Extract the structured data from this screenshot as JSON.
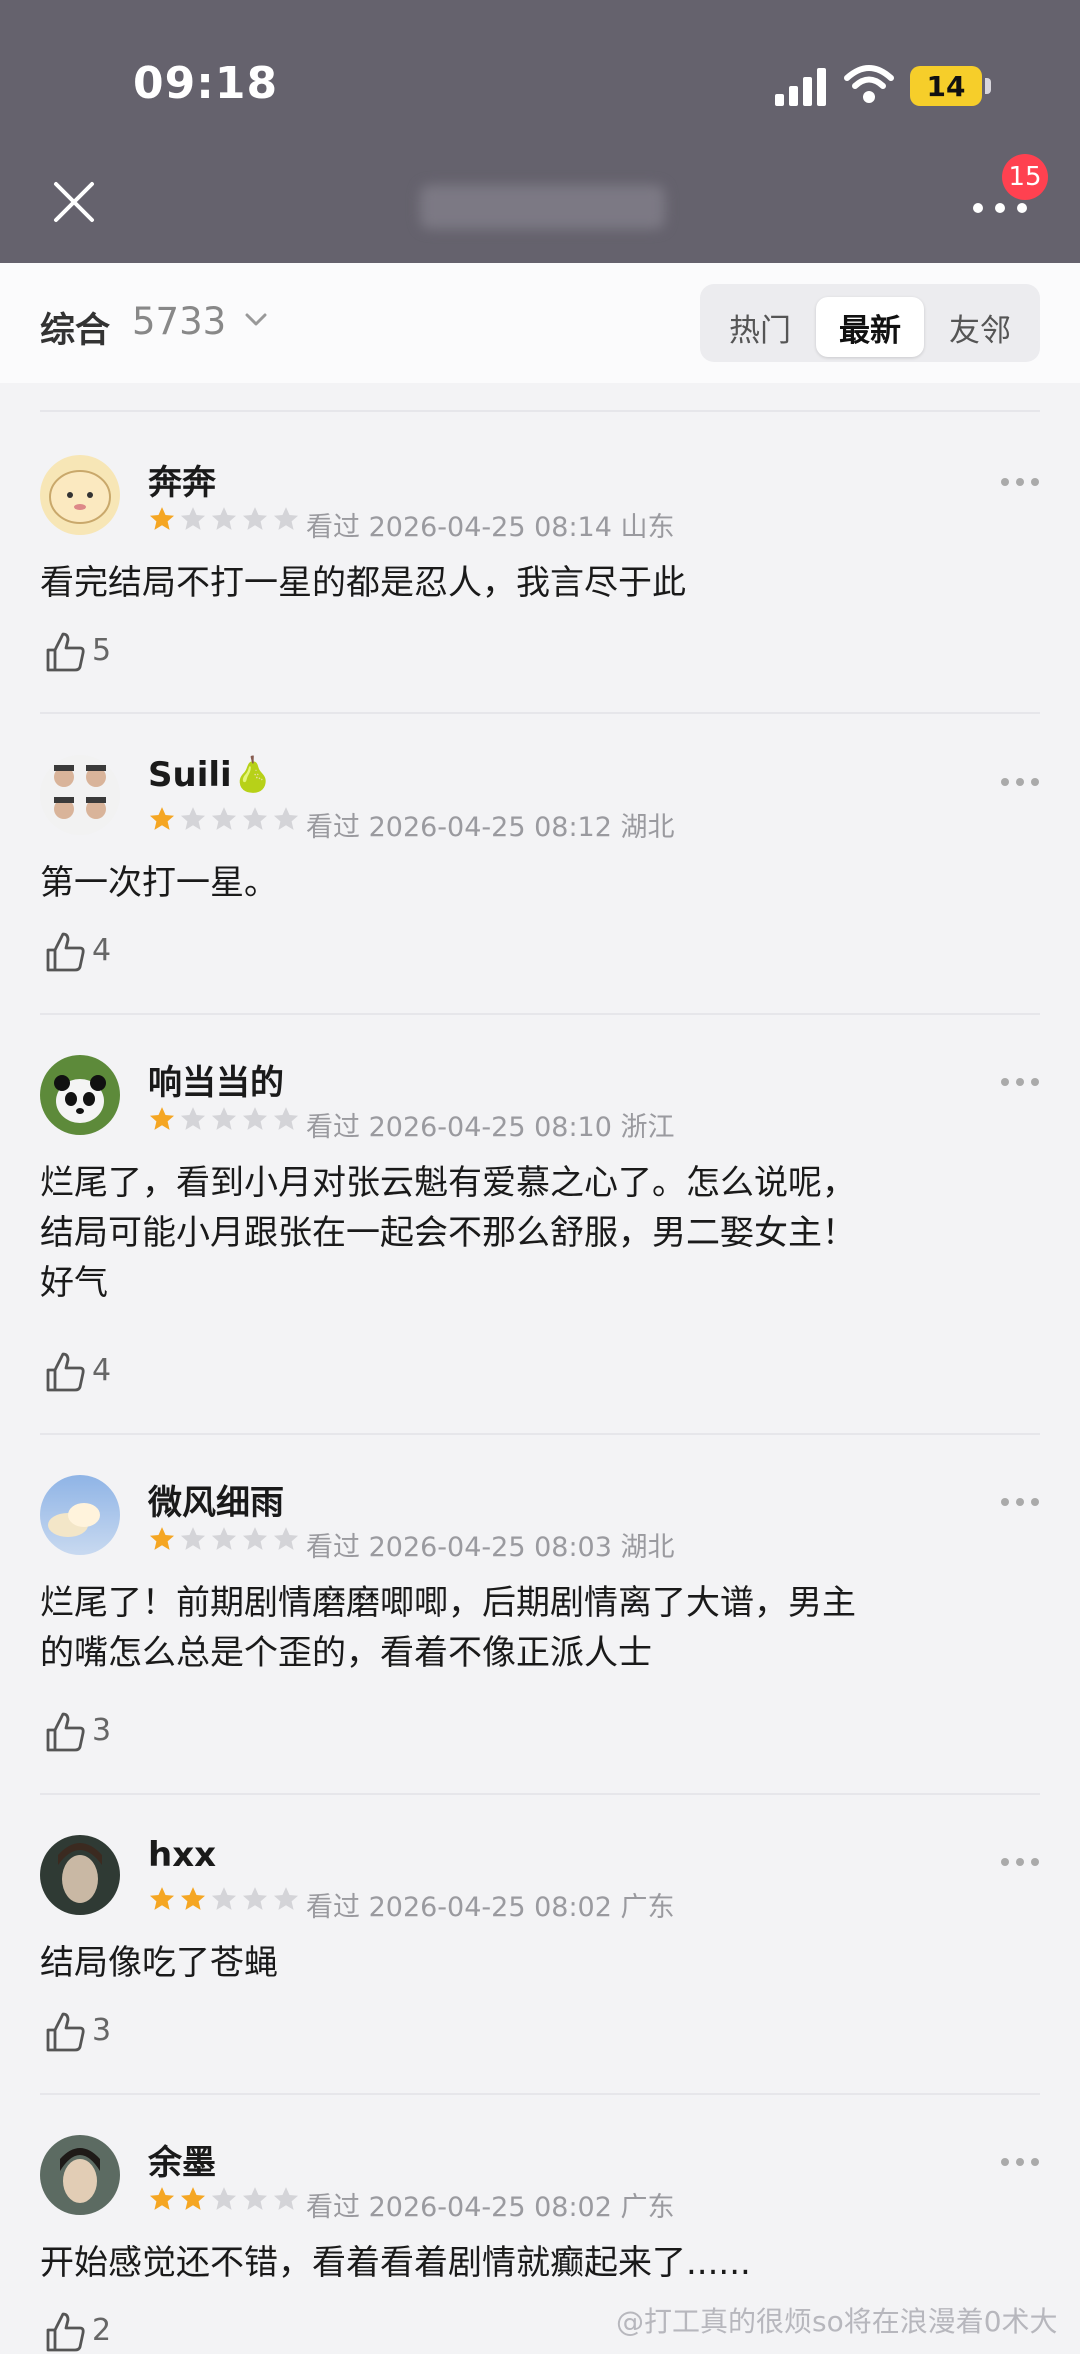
{
  "status_bar": {
    "time": "09:18",
    "battery": "14"
  },
  "nav": {
    "close_icon": "close-icon",
    "more_badge": "15"
  },
  "sort": {
    "label": "综合",
    "count": "5733",
    "tabs": [
      {
        "label": "热门",
        "active": false
      },
      {
        "label": "最新",
        "active": true
      },
      {
        "label": "友邻",
        "active": false
      }
    ]
  },
  "reviews": [
    {
      "name": "奔奔",
      "rating": 1,
      "watched": "看过",
      "date": "2026-04-25 08:14",
      "location": "山东",
      "lines": [
        "看完结局不打一星的都是忍人，我言尽于此"
      ],
      "likes": "5"
    },
    {
      "name": "Suili",
      "name_emoji": "🍐",
      "rating": 1,
      "watched": "看过",
      "date": "2026-04-25 08:12",
      "location": "湖北",
      "lines": [
        "第一次打一星。"
      ],
      "likes": "4"
    },
    {
      "name": "响当当的",
      "rating": 1,
      "watched": "看过",
      "date": "2026-04-25 08:10",
      "location": "浙江",
      "lines": [
        "烂尾了，看到小月对张云魁有爱慕之心了。怎么说呢，",
        "结局可能小月跟张在一起会不那么舒服，男二娶女主！",
        "好气"
      ],
      "likes": "4"
    },
    {
      "name": "微风细雨",
      "rating": 1,
      "watched": "看过",
      "date": "2026-04-25 08:03",
      "location": "湖北",
      "lines": [
        "烂尾了！前期剧情磨磨唧唧，后期剧情离了大谱，男主",
        "的嘴怎么总是个歪的，看着不像正派人士"
      ],
      "likes": "3"
    },
    {
      "name": "hxx",
      "rating": 2,
      "watched": "看过",
      "date": "2026-04-25 08:02",
      "location": "广东",
      "lines": [
        "结局像吃了苍蝇"
      ],
      "likes": "3"
    },
    {
      "name": "余墨",
      "rating": 2,
      "watched": "看过",
      "date": "2026-04-25 08:02",
      "location": "广东",
      "lines": [
        "开始感觉还不错，看着看着剧情就癫起来了......"
      ],
      "likes": "2"
    }
  ],
  "watermark": "@打工真的很烦so将在浪漫着0术大",
  "colors": {
    "star_filled": "#f5a623",
    "star_empty": "#d4d4d8",
    "badge": "#ff4150",
    "header_bg": "#65626d"
  }
}
